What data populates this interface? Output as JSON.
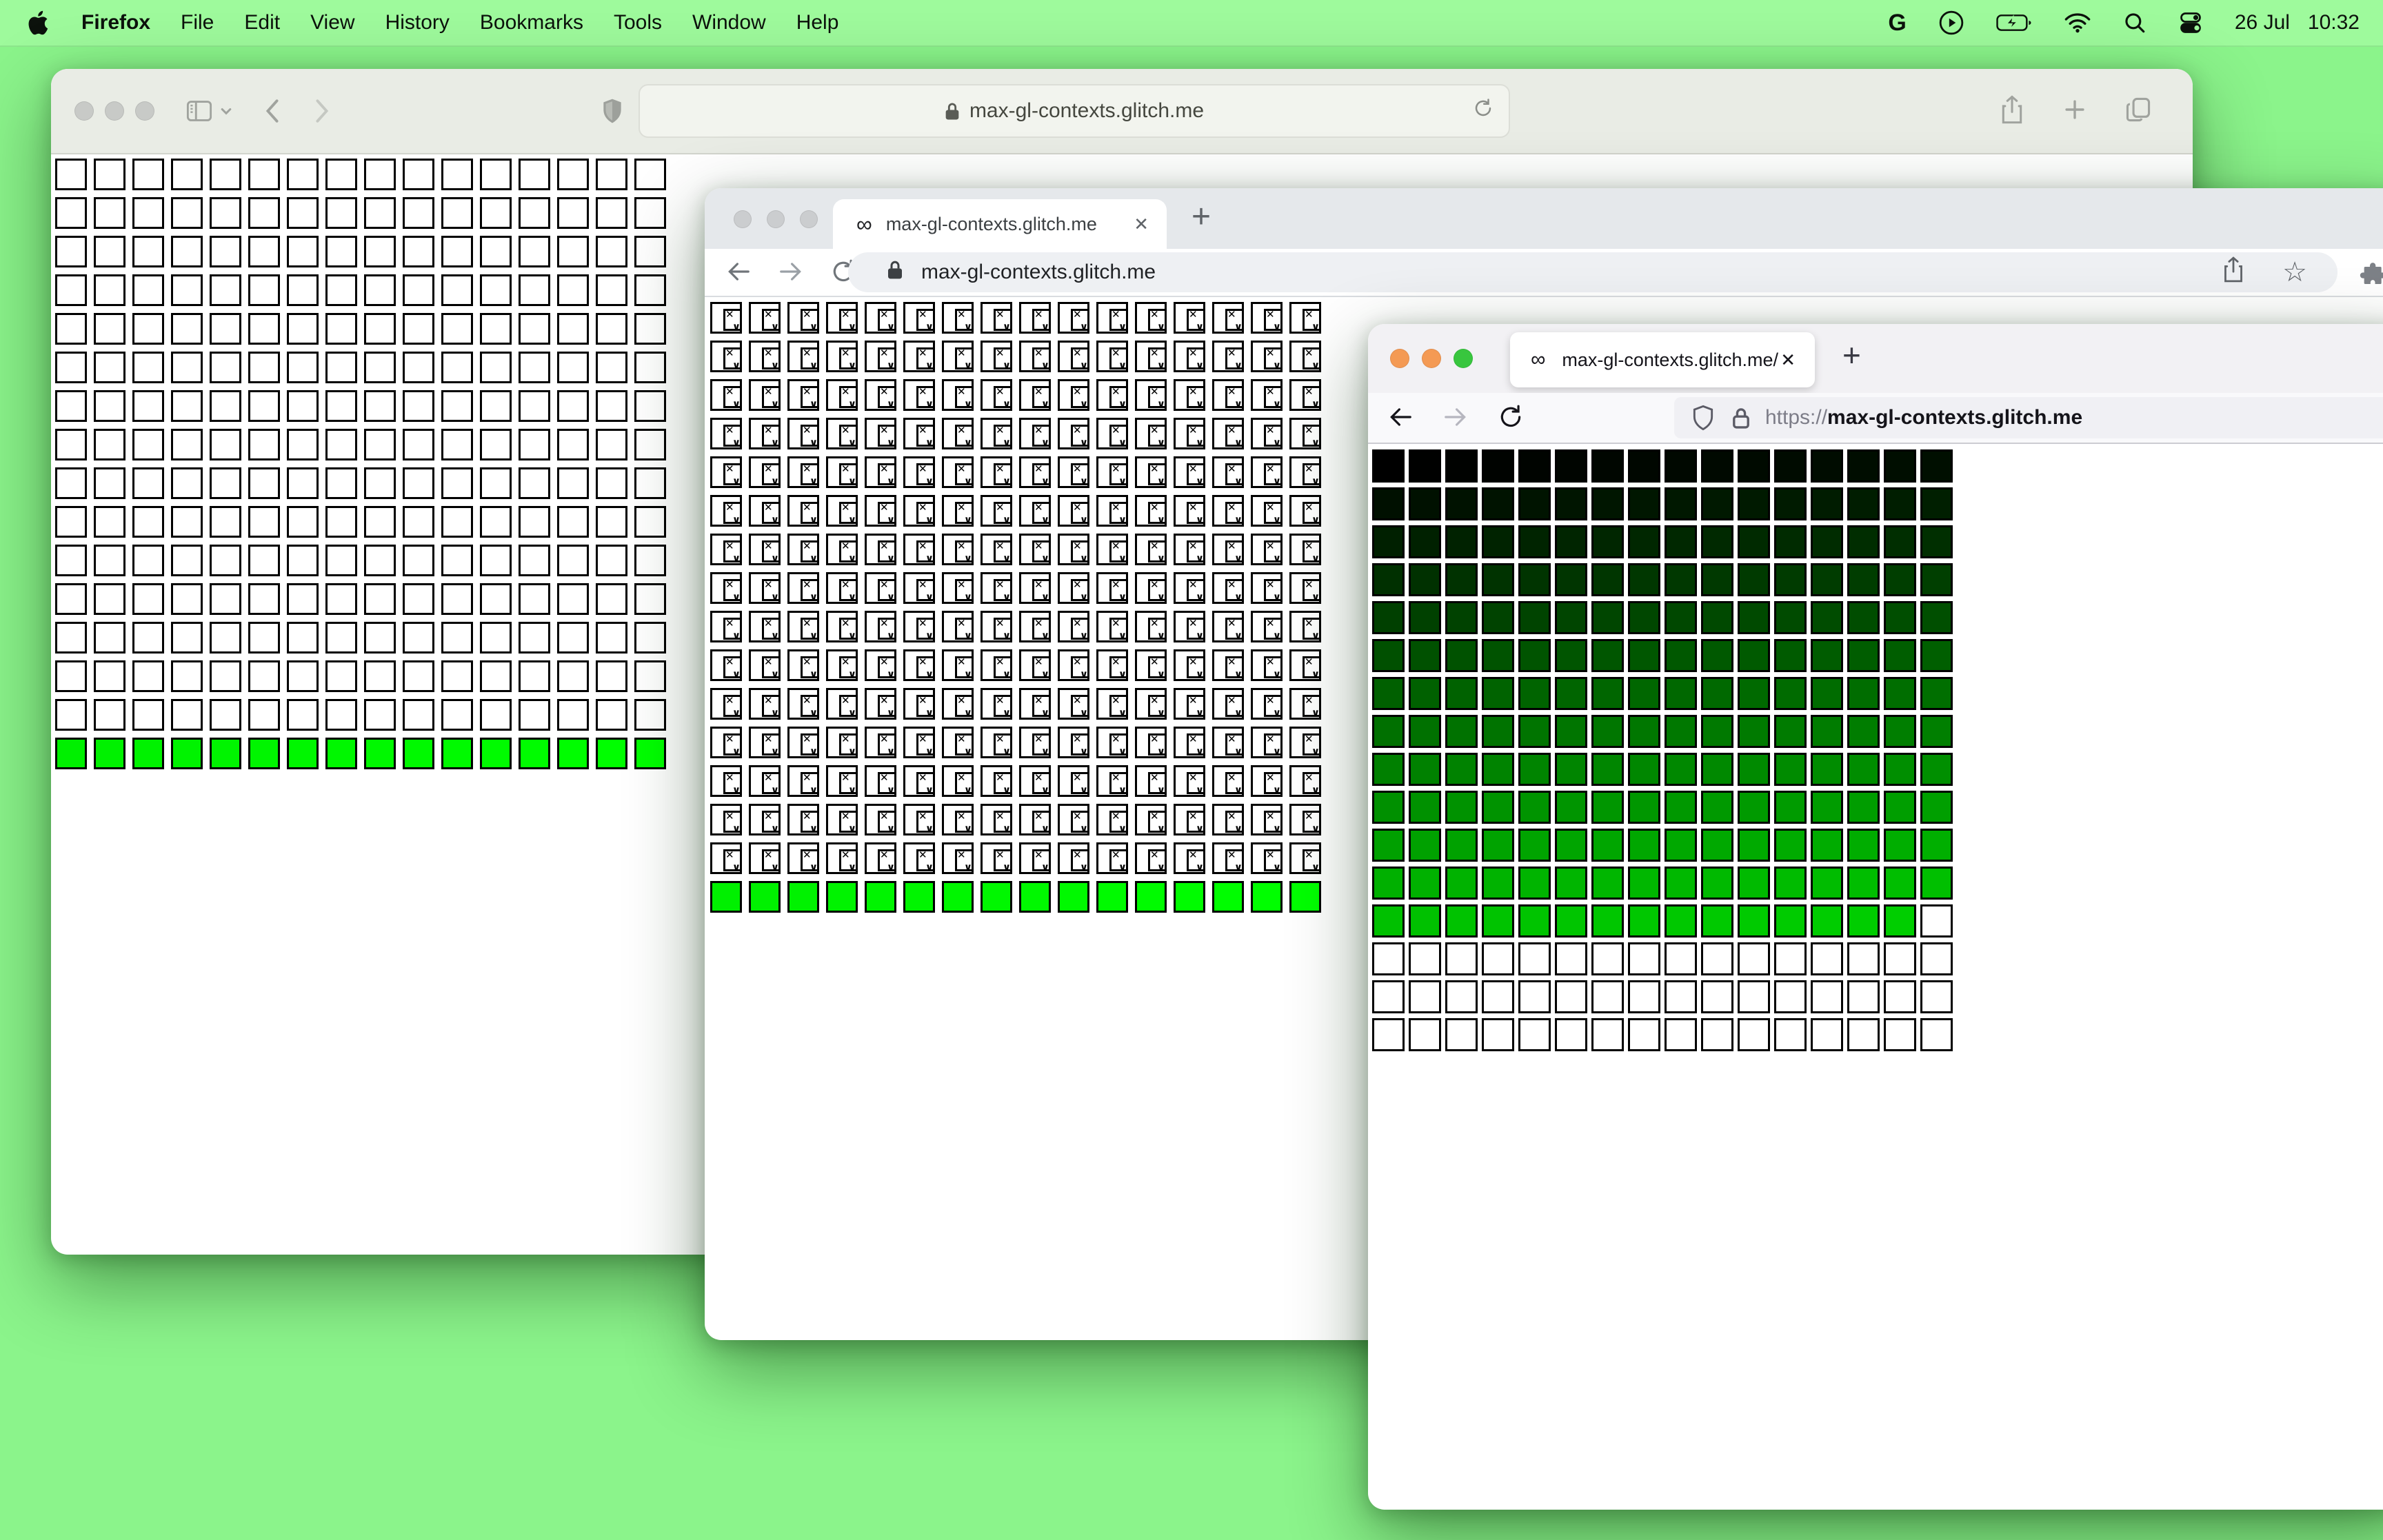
{
  "menu_bar": {
    "app_name": "Firefox",
    "menus": [
      "File",
      "Edit",
      "View",
      "History",
      "Bookmarks",
      "Tools",
      "Window",
      "Help"
    ],
    "status": {
      "google_glyph": "G",
      "date": "26 Jul",
      "time": "10:32"
    }
  },
  "windows": {
    "safari": {
      "browser": "Safari",
      "active": false,
      "url": "max-gl-contexts.glitch.me"
    },
    "chrome": {
      "browser": "Chrome",
      "active": false,
      "tab": {
        "favicon": "∞",
        "title": "max-gl-contexts.glitch.me",
        "close": "✕"
      },
      "new_tab": "+",
      "url": "max-gl-contexts.glitch.me"
    },
    "firefox": {
      "browser": "Firefox",
      "active": true,
      "tab": {
        "favicon": "∞",
        "title": "max-gl-contexts.glitch.me/",
        "close": "✕"
      },
      "new_tab": "+",
      "url_scheme": "https://",
      "url_host": "max-gl-contexts.glitch.me"
    }
  },
  "grids": {
    "safari": {
      "cols": 16,
      "rows": 16,
      "pattern": "plain",
      "blank_color": "#ffffff",
      "green_start": 240,
      "cell_name": "gl-canvas-cell-white"
    },
    "chrome": {
      "cols": 16,
      "rows": 16,
      "pattern": "broken",
      "blank_color": "#ffffff",
      "green_start": 240,
      "cell_name": "broken-image-cell"
    },
    "firefox": {
      "cols": 16,
      "rows": 16,
      "pattern": "ramp",
      "colored_cells": 207,
      "green_max": 206,
      "blank_color": "#ffffff",
      "cell_name": "gl-canvas-cell-gradient"
    }
  },
  "icons": {
    "broken_x": "✕",
    "broken_wave": "∨",
    "star": "☆"
  },
  "colors": {
    "desktop": "#8bf48b",
    "menubar": "#9efa9c",
    "safari_toolbar": "#e9ece5",
    "chrome_strip": "#e5e8eb",
    "firefox_strip": "#f2f1f4",
    "inactive_traffic_light": "#c9cbc8",
    "firefox_traffic_lights": [
      "#f49a54",
      "#f49a54",
      "#38c63e"
    ],
    "cell_border": "#000000"
  }
}
